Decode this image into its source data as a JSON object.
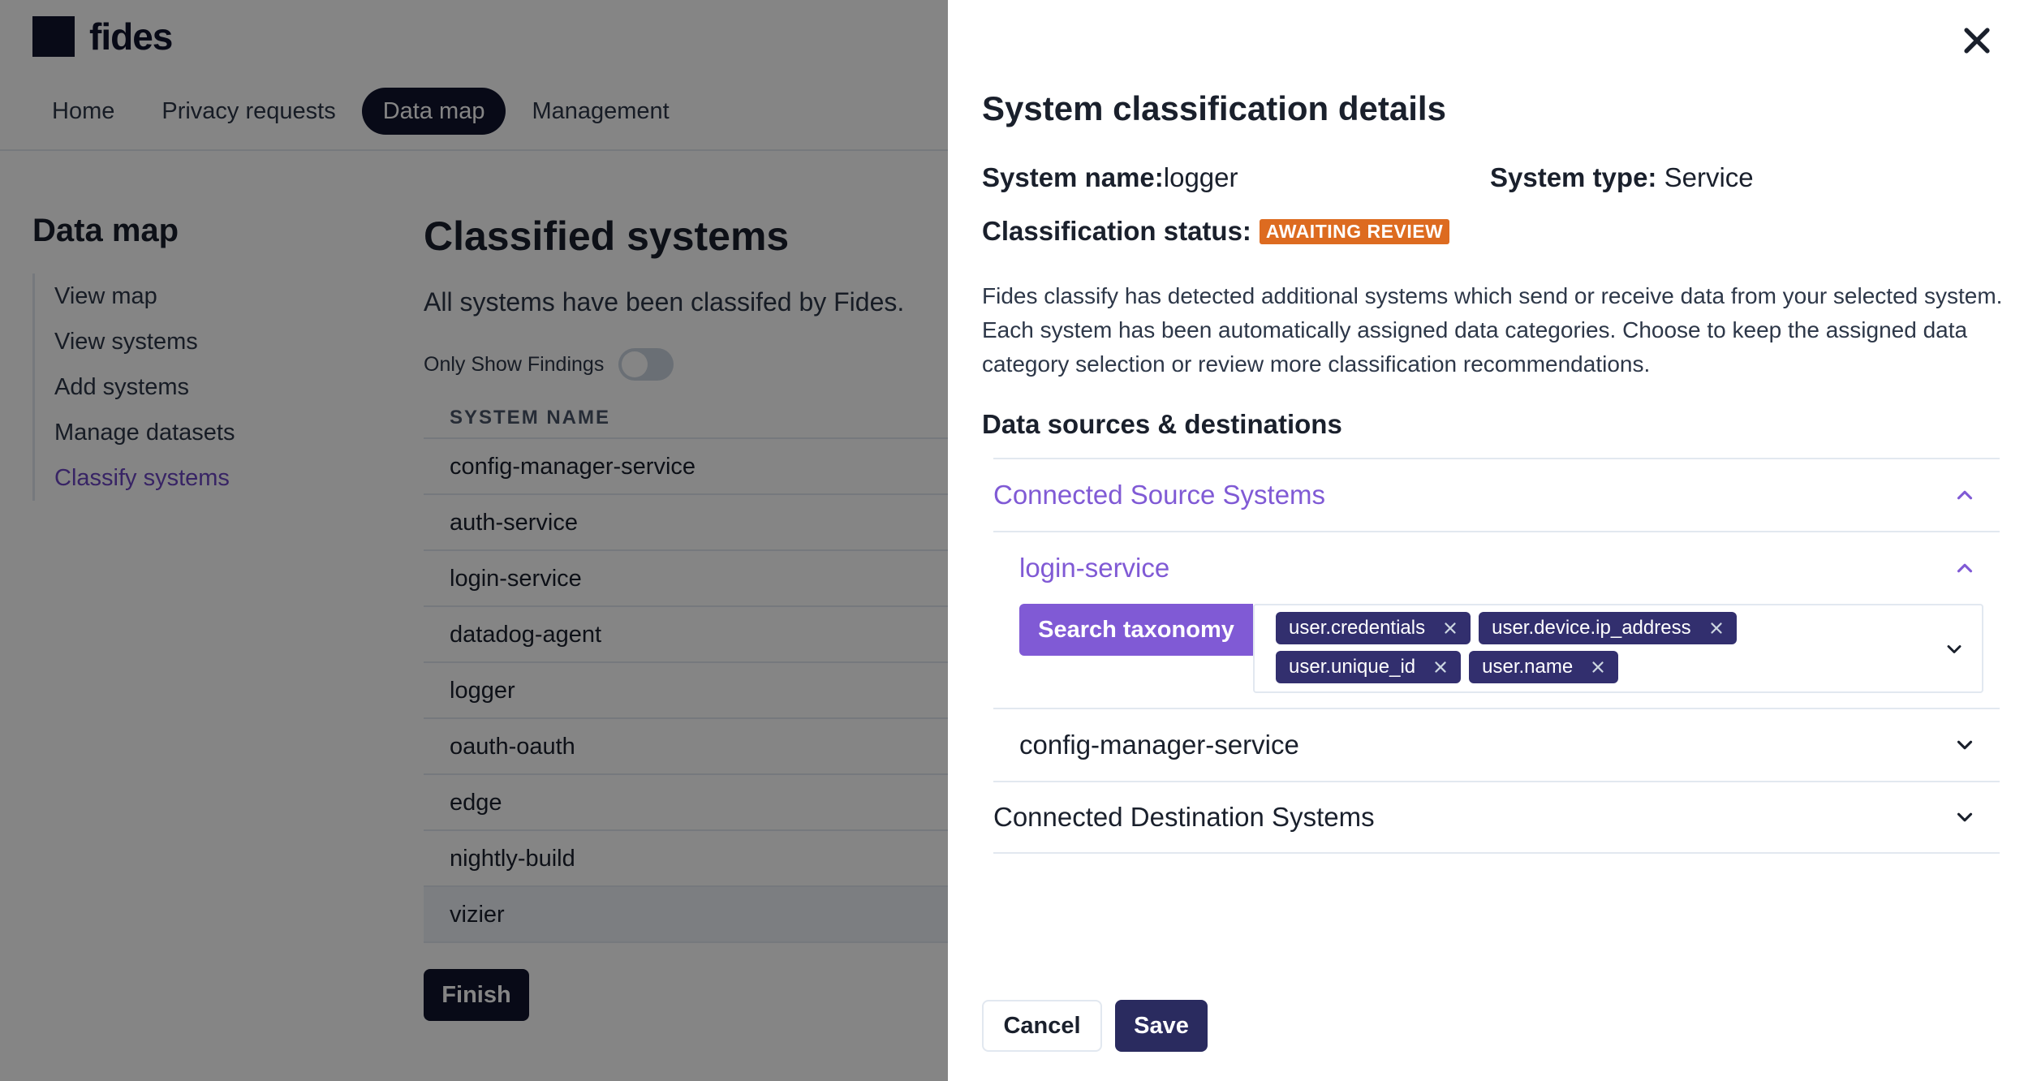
{
  "app": {
    "logo_text": "fides",
    "nav": [
      {
        "label": "Home",
        "active": false
      },
      {
        "label": "Privacy requests",
        "active": false
      },
      {
        "label": "Data map",
        "active": true
      },
      {
        "label": "Management",
        "active": false
      }
    ],
    "sidebar": {
      "title": "Data map",
      "items": [
        "View map",
        "View systems",
        "Add systems",
        "Manage datasets",
        "Classify systems"
      ]
    },
    "main": {
      "title": "Classified systems",
      "description": "All systems have been classifed by Fides.",
      "toggle_label": "Only Show Findings",
      "column_header": "SYSTEM NAME",
      "rows": [
        "config-manager-service",
        "auth-service",
        "login-service",
        "datadog-agent",
        "logger",
        "oauth-oauth",
        "edge",
        "nightly-build",
        "vizier"
      ],
      "finish_label": "Finish"
    }
  },
  "drawer": {
    "title": "System classification details",
    "system_name_label": "System name:",
    "system_name_value": "logger",
    "system_type_label": "System type:",
    "system_type_value": "Service",
    "status_label": "Classification status:",
    "status_value": "AWAITING REVIEW",
    "description": "Fides classify has detected additional systems which send or receive data from your selected system. Each system has been automatically assigned data categories. Choose to keep the assigned data category selection or review more classification recommendations.",
    "section_title": "Data sources & destinations",
    "source_label": "Connected Source Systems",
    "source_systems": [
      {
        "name": "login-service",
        "expanded": true,
        "search_label": "Search taxonomy",
        "tags": [
          "user.credentials",
          "user.device.ip_address",
          "user.unique_id",
          "user.name"
        ]
      },
      {
        "name": "config-manager-service",
        "expanded": false
      }
    ],
    "destination_label": "Connected Destination Systems",
    "cancel_label": "Cancel",
    "save_label": "Save"
  },
  "colors": {
    "brand_dark": "#11142d",
    "accent_purple": "#805ad5",
    "tag_bg": "#322f6e",
    "status_orange": "#dd6b20"
  },
  "icons": [
    "close-icon",
    "chevron-up-icon",
    "chevron-down-icon",
    "tag-remove-icon",
    "toggle-switch"
  ]
}
